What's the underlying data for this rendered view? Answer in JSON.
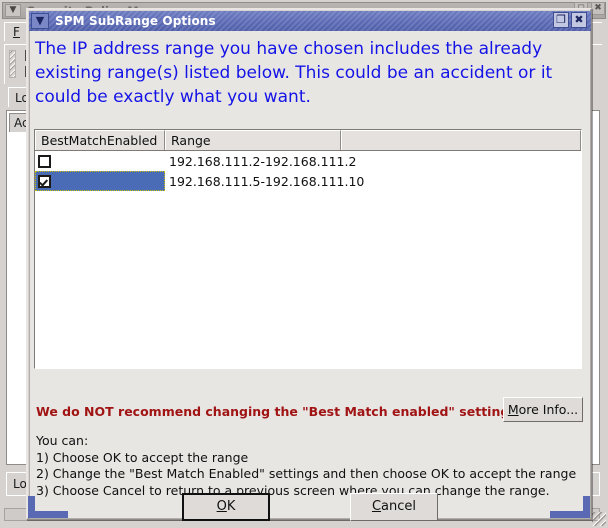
{
  "background_window": {
    "title": "Security Policy Manager",
    "menu_file": "File",
    "menu_file_mnemonic": "F",
    "tab_label": "Log",
    "panel_header": "Ac",
    "status_text": "Log",
    "titlebar_icons": {
      "menu": "chevron-down-icon",
      "maximize": "maximize-icon",
      "close": "close-icon"
    },
    "scroll_left_arrow": "◄"
  },
  "dialog": {
    "title": "SPM SubRange Options",
    "titlebar_icons": {
      "menu": "chevron-down-icon",
      "menu_glyph": "▼",
      "maximize": "maximize-icon",
      "maximize_glyph": "❐",
      "close": "close-icon",
      "close_glyph": "✖"
    },
    "message": "The IP address range you have chosen includes the already existing range(s) listed below. This could be an accident or it could be exactly what you want.",
    "message_color": "#1414e6",
    "table": {
      "columns": [
        "BestMatchEnabled",
        "Range",
        ""
      ],
      "rows": [
        {
          "best_match_enabled": false,
          "range": "192.168.111.2-192.168.111.2",
          "selected": false
        },
        {
          "best_match_enabled": true,
          "range": "192.168.111.5-192.168.111.10",
          "selected": true
        }
      ],
      "selection_color": "#4a6bb5"
    },
    "warning": {
      "text": "We do NOT recommend changing the \"Best Match enabled\" settings",
      "color": "#a01414"
    },
    "more_info_button": {
      "label": "More Info...",
      "mnemonic": "M",
      "label_rest": "ore Info..."
    },
    "instructions": {
      "heading": "You can:",
      "items": [
        "1) Choose OK to accept the range",
        "2) Change the \"Best Match Enabled\" settings and then choose OK to accept the range",
        "3) Choose Cancel to return to a previous screen where you can change the range."
      ]
    },
    "ok_button": {
      "mnemonic": "O",
      "label_rest": "K"
    },
    "cancel_button": {
      "mnemonic": "C",
      "label_rest": "ancel"
    }
  }
}
